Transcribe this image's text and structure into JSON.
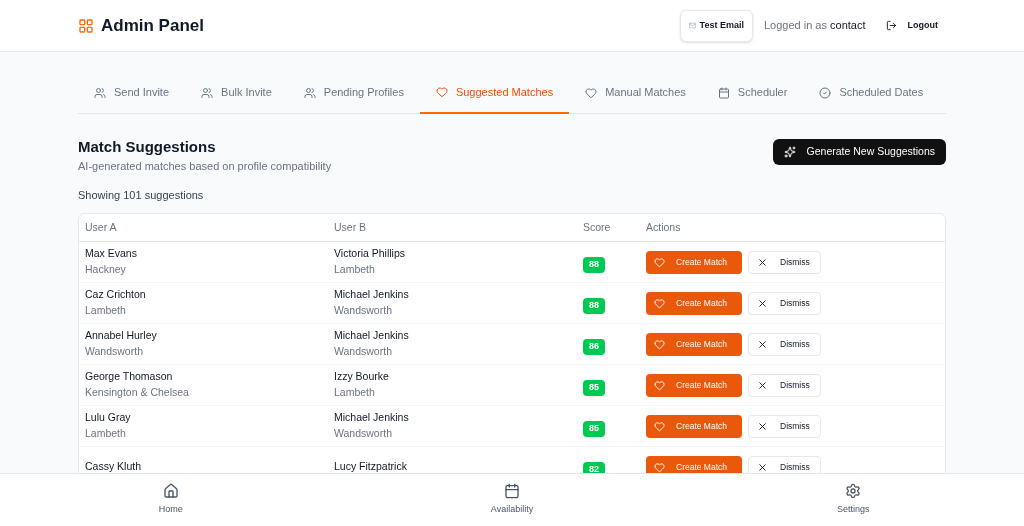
{
  "header": {
    "title": "Admin Panel",
    "test_email_button": "Test Email",
    "logged_in_label": "Logged in as",
    "logged_in_user": "contact",
    "logout_button": "Logout"
  },
  "tabs": [
    {
      "label": "Send Invite",
      "selected": false
    },
    {
      "label": "Bulk Invite",
      "selected": false
    },
    {
      "label": "Pending Profiles",
      "selected": false
    },
    {
      "label": "Suggested Matches",
      "selected": true
    },
    {
      "label": "Manual Matches",
      "selected": false
    },
    {
      "label": "Scheduler",
      "selected": false
    },
    {
      "label": "Scheduled Dates",
      "selected": false
    }
  ],
  "section": {
    "title": "Match Suggestions",
    "subtitle": "AI-generated matches based on profile compatibility",
    "generate_button": "Generate New Suggestions",
    "count": "Showing 101 suggestions"
  },
  "table": {
    "columns": [
      "User A",
      "User B",
      "Score",
      "Actions"
    ],
    "rows": [
      {
        "user_a": "Max Evans",
        "location_a": "Hackney",
        "user_b": "Victoria Phillips",
        "location_b": "Lambeth",
        "score": "88",
        "create": "Create Match",
        "dismiss": "Dismiss"
      },
      {
        "user_a": "Caz Crichton",
        "location_a": "Lambeth",
        "user_b": "Michael Jenkins",
        "location_b": "Wandsworth",
        "score": "88",
        "create": "Create Match",
        "dismiss": "Dismiss"
      },
      {
        "user_a": "Annabel Hurley",
        "location_a": "Wandsworth",
        "user_b": "Michael Jenkins",
        "location_b": "Wandsworth",
        "score": "86",
        "create": "Create Match",
        "dismiss": "Dismiss"
      },
      {
        "user_a": "George Thomason",
        "location_a": "Kensington & Chelsea",
        "user_b": "Izzy Bourke",
        "location_b": "Lambeth",
        "score": "85",
        "create": "Create Match",
        "dismiss": "Dismiss"
      },
      {
        "user_a": "Lulu Gray",
        "location_a": "Lambeth",
        "user_b": "Michael Jenkins",
        "location_b": "Wandsworth",
        "score": "85",
        "create": "Create Match",
        "dismiss": "Dismiss"
      },
      {
        "user_a": "Cassy Kluth",
        "user_b": "Lucy Fitzpatrick",
        "score": "82",
        "create": "Create Match",
        "dismiss": "Dismiss"
      }
    ]
  },
  "bottom_nav": [
    {
      "label": "Home"
    },
    {
      "label": "Availability"
    },
    {
      "label": "Settings"
    }
  ]
}
